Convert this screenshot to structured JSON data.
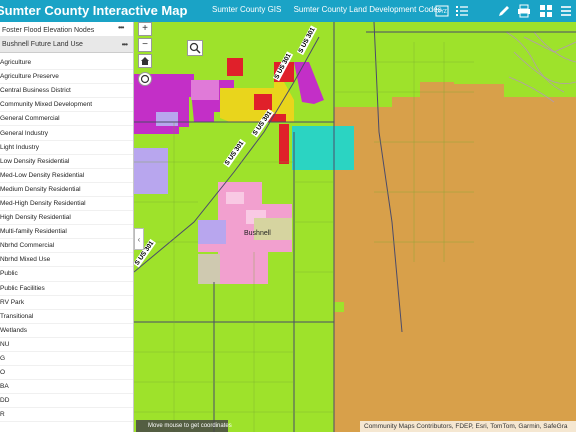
{
  "header": {
    "app_title": "Sumter County Interactive Map",
    "links": [
      "Sumter County GIS",
      "Sumter County Land Development Codes"
    ],
    "tools": [
      {
        "name": "basemap-gallery-icon",
        "label": ""
      },
      {
        "name": "layer-list-icon",
        "label": ""
      },
      {
        "name": "draw-icon",
        "label": ""
      },
      {
        "name": "print-icon",
        "label": ""
      },
      {
        "name": "widgets-grid-icon",
        "label": ""
      },
      {
        "name": "menu-icon",
        "label": ""
      }
    ],
    "colors": {
      "bar": "#1aa3c6",
      "text": "#ffffff"
    }
  },
  "sidebar": {
    "flood_layer": "Foster Flood Elevation Nodes",
    "flu_layer": "Bushnell Future Land Use",
    "more_label": "•••",
    "legend": [
      "Agriculture",
      "Agriculture Preserve",
      "Central Business District",
      "Community Mixed Development",
      "General Commercial",
      "General Industry",
      "Light Industry",
      "Low Density Residential",
      "Med-Low Density Residential",
      "Medium Density Residential",
      "Med-High Density Residential",
      "High Density Residential",
      "Multi-family Residential",
      "Nbrhd Commercial",
      "Nbrhd Mixed Use",
      "Public",
      "Public Facilities",
      "RV Park",
      "Transitional",
      "Wetlands",
      "NU",
      "G",
      "O",
      "BA",
      "DD",
      "R"
    ]
  },
  "map": {
    "zoom_in": "+",
    "zoom_out": "−",
    "home_icon": "home-icon",
    "locate_icon": "locate-icon",
    "town_label": "Bushnell",
    "road_label": "S US 301",
    "attribution": "Community Maps Contributors, FDEP, Esri, TomTom, Garmin, SafeGra",
    "coordinates_hint": "Move mouse to get coordinates",
    "collapse_arrow": "‹",
    "colors": {
      "agriculture": "#9ee22b",
      "orange_zone": "#d8a04a",
      "magenta": "#c32fc7",
      "yellow": "#e9d51c",
      "cyan": "#2bd4c2",
      "red": "#e0202a",
      "pink": "#f2a0cf",
      "lavender": "#b8a6ee",
      "grey": "#cfc9b0"
    }
  }
}
